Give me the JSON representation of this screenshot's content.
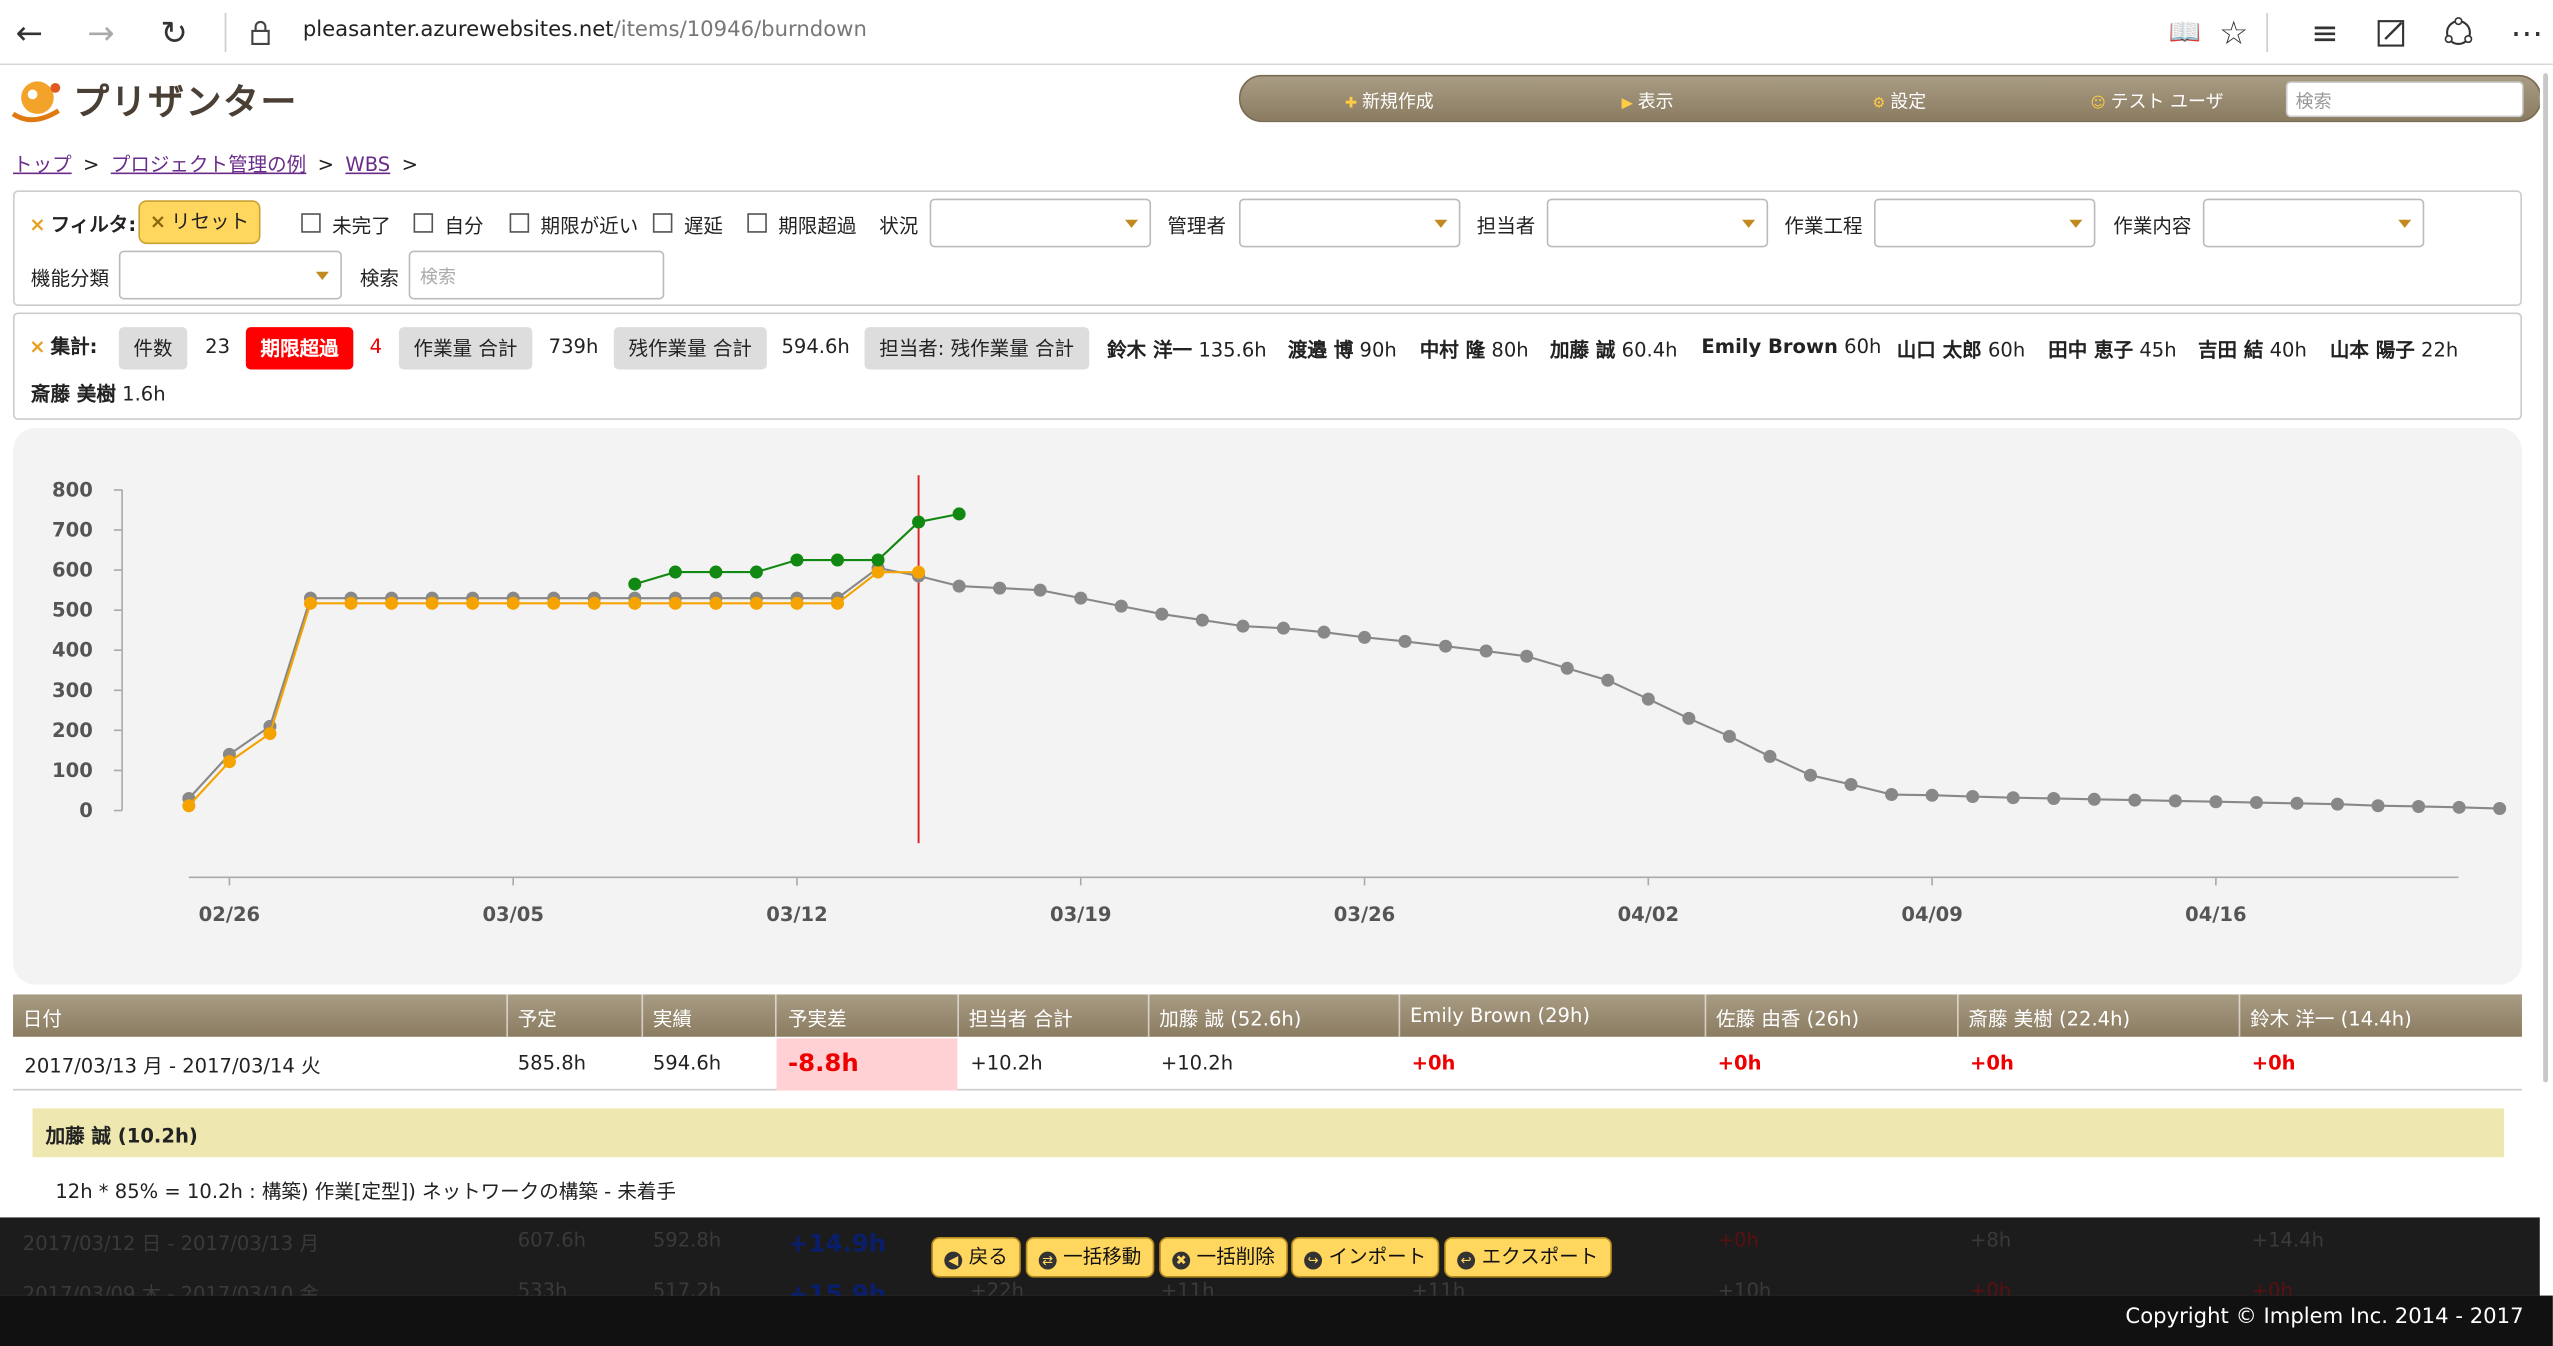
{
  "browser": {
    "url_host": "pleasanter.azurewebsites.net",
    "url_path": "/items/10946/burndown"
  },
  "header": {
    "logo": "プリザンター",
    "menu": [
      "新規作成",
      "表示",
      "設定",
      "テスト ユーザ"
    ],
    "search_placeholder": "検索"
  },
  "breadcrumb": [
    "トップ",
    "プロジェクト管理の例",
    "WBS"
  ],
  "filter": {
    "label": "フィルタ:",
    "reset": "リセット",
    "checkboxes": [
      "未完了",
      "自分",
      "期限が近い",
      "遅延",
      "期限超過"
    ],
    "selects": [
      "状況",
      "管理者",
      "担当者",
      "作業工程",
      "作業内容",
      "機能分類"
    ],
    "search_label": "検索",
    "search_placeholder": "検索"
  },
  "summary": {
    "label": "集計:",
    "count_label": "件数",
    "count": "23",
    "overdue_label": "期限超過",
    "overdue": "4",
    "workload_label": "作業量 合計",
    "workload": "739h",
    "remaining_label": "残作業量 合計",
    "remaining": "594.6h",
    "assignee_label": "担当者: 残作業量 合計",
    "assignees": [
      {
        "name": "鈴木 洋一",
        "value": "135.6h"
      },
      {
        "name": "渡邉 博",
        "value": "90h"
      },
      {
        "name": "中村 隆",
        "value": "80h"
      },
      {
        "name": "加藤 誠",
        "value": "60.4h"
      },
      {
        "name": "Emily Brown",
        "value": "60h"
      },
      {
        "name": "山口 太郎",
        "value": "60h"
      },
      {
        "name": "田中 恵子",
        "value": "45h"
      },
      {
        "name": "吉田 結",
        "value": "40h"
      },
      {
        "name": "山本 陽子",
        "value": "22h"
      },
      {
        "name": "斎藤 美樹",
        "value": "1.6h"
      }
    ]
  },
  "chart_data": {
    "type": "line",
    "y_ticks": [
      "800",
      "700",
      "600",
      "500",
      "400",
      "300",
      "200",
      "100",
      "0"
    ],
    "ylim": [
      0,
      800
    ],
    "x_ticks": [
      "02/26",
      "03/05",
      "03/12",
      "03/19",
      "03/26",
      "04/02",
      "04/09",
      "04/16"
    ],
    "x_start": "2017-02-25",
    "today": "2017-03-15",
    "colors": {
      "plan": "#888888",
      "actual": "#f5a300",
      "earned": "#118811",
      "today_line": "#dd2222"
    },
    "series": [
      {
        "name": "plan",
        "color": "#888888",
        "values": [
          30,
          140,
          210,
          530,
          530,
          530,
          530,
          530,
          530,
          530,
          530,
          530,
          530,
          530,
          530,
          530,
          530,
          605,
          585,
          560,
          555,
          550,
          530,
          510,
          490,
          475,
          460,
          455,
          445,
          432,
          422,
          410,
          398,
          385,
          355,
          325,
          278,
          230,
          185,
          135,
          88,
          65,
          40,
          38,
          35,
          32,
          30,
          28,
          26,
          24,
          22,
          20,
          18,
          16,
          12,
          10,
          8,
          5
        ]
      },
      {
        "name": "actual",
        "color": "#f5a300",
        "values": [
          12,
          122,
          192,
          517,
          517,
          517,
          517,
          517,
          517,
          517,
          517,
          517,
          517,
          517,
          517,
          517,
          517,
          595,
          594.6
        ]
      },
      {
        "name": "earned",
        "color": "#118811",
        "values": [
          null,
          null,
          null,
          null,
          null,
          null,
          null,
          null,
          null,
          null,
          null,
          565,
          595,
          595,
          595,
          625,
          625,
          625,
          720,
          740
        ]
      }
    ]
  },
  "table": {
    "headers": [
      "日付",
      "予定",
      "実績",
      "予実差",
      "担当者 合計",
      "加藤 誠 (52.6h)",
      "Emily Brown (29h)",
      "佐藤 由香 (26h)",
      "斎藤 美樹 (22.4h)",
      "鈴木 洋一 (14.4h)"
    ],
    "row1": {
      "date": "2017/03/13 月 - 2017/03/14 火",
      "plan": "585.8h",
      "actual": "594.6h",
      "diff": "-8.8h",
      "total": "+10.2h",
      "kato": "+10.2h",
      "emily": "+0h",
      "sato": "+0h",
      "saito": "+0h",
      "suzuki": "+0h"
    },
    "detail_title": "加藤 誠 (10.2h)",
    "detail_line": "12h * 85% = 10.2h : 構築) 作業[定型]) ネットワークの構築 - 未着手",
    "row2": {
      "date": "2017/03/12 日 - 2017/03/13 月",
      "plan": "607.6h",
      "actual": "592.8h",
      "diff": "+14.9h",
      "a": "+0h",
      "b": "+8h",
      "c": "+14.4h"
    },
    "row3": {
      "date": "2017/03/09 木 - 2017/03/10 金",
      "plan": "533h",
      "actual": "517.2h",
      "diff": "+15.9h",
      "a": "+22h",
      "b": "+11h",
      "c": "+11h",
      "d": "+10h",
      "e": "+0h",
      "f": "+0h"
    }
  },
  "actions": [
    "戻る",
    "一括移動",
    "一括削除",
    "インポート",
    "エクスポート"
  ],
  "footer": {
    "copyright": "Copyright © Implem Inc. 2014 - 2017"
  }
}
